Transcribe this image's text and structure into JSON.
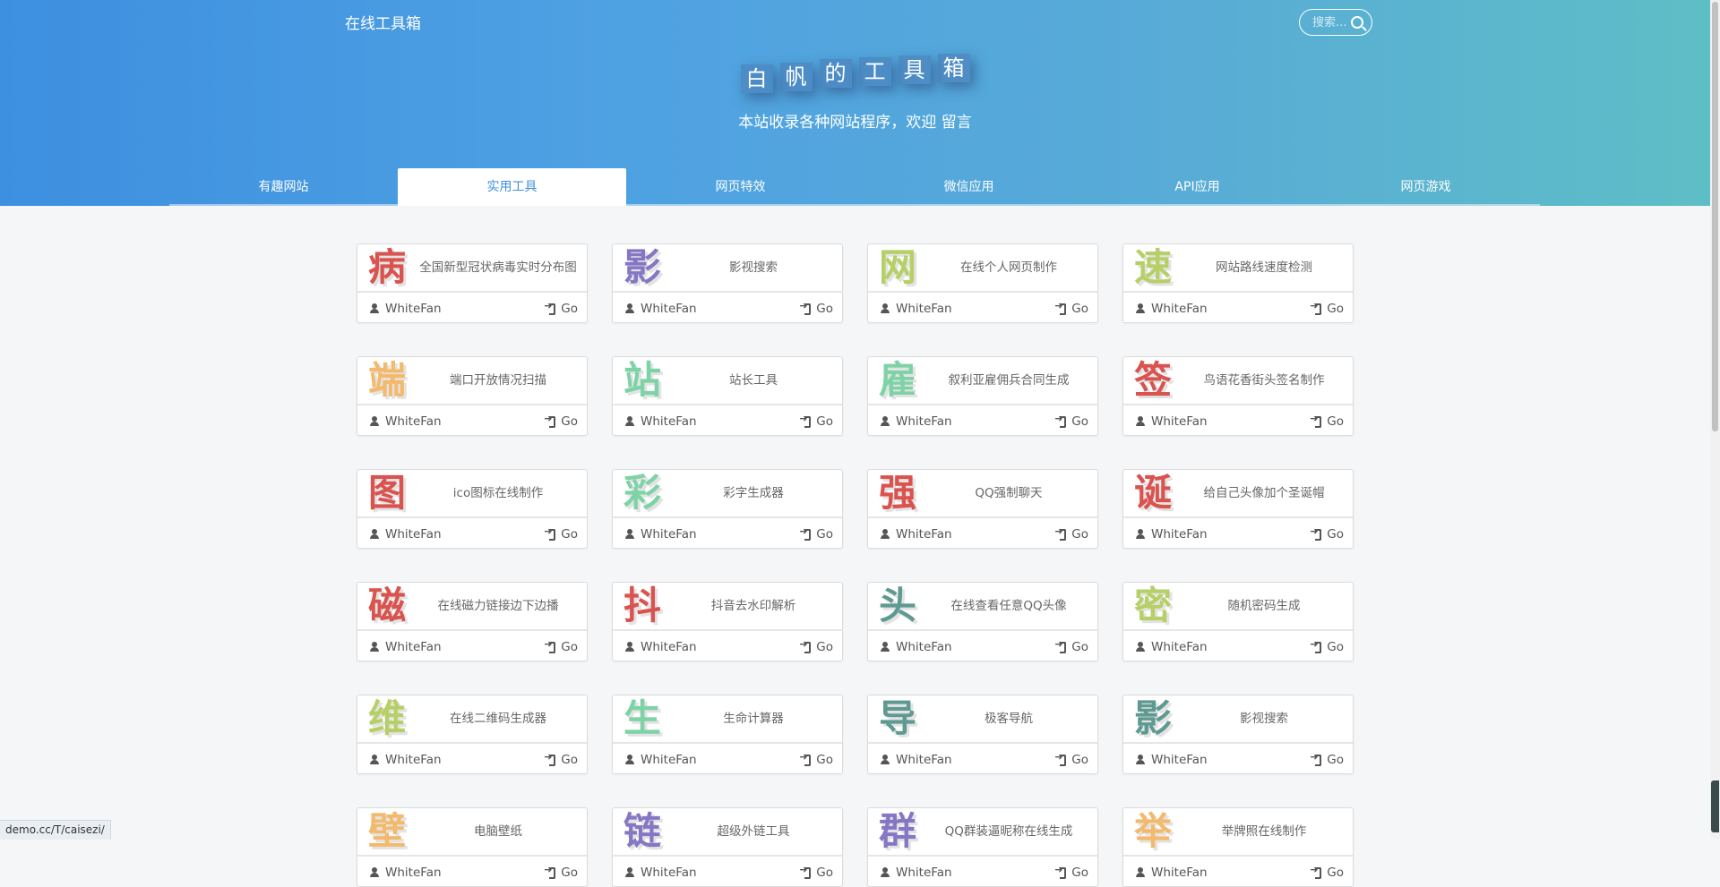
{
  "header": {
    "brand": "在线工具箱",
    "search_placeholder": "搜索...",
    "title_chars": [
      "白",
      "帆",
      "的",
      "工",
      "具",
      "箱"
    ],
    "subtitle_prefix": "本站收录各种网站程序，欢迎",
    "subtitle_link": "留言"
  },
  "tabs": [
    {
      "label": "有趣网站",
      "active": false
    },
    {
      "label": "实用工具",
      "active": true
    },
    {
      "label": "网页特效",
      "active": false
    },
    {
      "label": "微信应用",
      "active": false
    },
    {
      "label": "API应用",
      "active": false
    },
    {
      "label": "网页游戏",
      "active": false
    }
  ],
  "cards": [
    {
      "char": "病",
      "color": "#d9534f",
      "title": "全国新型冠状病毒实时分布图",
      "author": "WhiteFan",
      "go": "Go"
    },
    {
      "char": "影",
      "color": "#8577c4",
      "title": "影视搜索",
      "author": "WhiteFan",
      "go": "Go"
    },
    {
      "char": "网",
      "color": "#b6cf66",
      "title": "在线个人网页制作",
      "author": "WhiteFan",
      "go": "Go"
    },
    {
      "char": "速",
      "color": "#b6cf66",
      "title": "网站路线速度检测",
      "author": "WhiteFan",
      "go": "Go"
    },
    {
      "char": "端",
      "color": "#f3b96c",
      "title": "端口开放情况扫描",
      "author": "WhiteFan",
      "go": "Go"
    },
    {
      "char": "站",
      "color": "#7ed3a6",
      "title": "站长工具",
      "author": "WhiteFan",
      "go": "Go"
    },
    {
      "char": "雇",
      "color": "#7ed3a6",
      "title": "叙利亚雇佣兵合同生成",
      "author": "WhiteFan",
      "go": "Go"
    },
    {
      "char": "签",
      "color": "#d9534f",
      "title": "鸟语花香街头签名制作",
      "author": "WhiteFan",
      "go": "Go"
    },
    {
      "char": "图",
      "color": "#d9534f",
      "title": "ico图标在线制作",
      "author": "WhiteFan",
      "go": "Go"
    },
    {
      "char": "彩",
      "color": "#7ed3a6",
      "title": "彩字生成器",
      "author": "WhiteFan",
      "go": "Go"
    },
    {
      "char": "强",
      "color": "#d9534f",
      "title": "QQ强制聊天",
      "author": "WhiteFan",
      "go": "Go"
    },
    {
      "char": "诞",
      "color": "#d9534f",
      "title": "给自己头像加个圣诞帽",
      "author": "WhiteFan",
      "go": "Go"
    },
    {
      "char": "磁",
      "color": "#d9534f",
      "title": "在线磁力链接边下边播",
      "author": "WhiteFan",
      "go": "Go"
    },
    {
      "char": "抖",
      "color": "#d9534f",
      "title": "抖音去水印解析",
      "author": "WhiteFan",
      "go": "Go"
    },
    {
      "char": "头",
      "color": "#5f9a92",
      "title": "在线查看任意QQ头像",
      "author": "WhiteFan",
      "go": "Go"
    },
    {
      "char": "密",
      "color": "#b6cf66",
      "title": "随机密码生成",
      "author": "WhiteFan",
      "go": "Go"
    },
    {
      "char": "维",
      "color": "#b6cf66",
      "title": "在线二维码生成器",
      "author": "WhiteFan",
      "go": "Go"
    },
    {
      "char": "生",
      "color": "#7ed3a6",
      "title": "生命计算器",
      "author": "WhiteFan",
      "go": "Go"
    },
    {
      "char": "导",
      "color": "#5f9a92",
      "title": "极客导航",
      "author": "WhiteFan",
      "go": "Go"
    },
    {
      "char": "影",
      "color": "#5f9a92",
      "title": "影视搜索",
      "author": "WhiteFan",
      "go": "Go"
    },
    {
      "char": "壁",
      "color": "#f3b96c",
      "title": "电脑壁纸",
      "author": "WhiteFan",
      "go": "Go"
    },
    {
      "char": "链",
      "color": "#8577c4",
      "title": "超级外链工具",
      "author": "WhiteFan",
      "go": "Go"
    },
    {
      "char": "群",
      "color": "#8577c4",
      "title": "QQ群装逼昵称在线生成",
      "author": "WhiteFan",
      "go": "Go"
    },
    {
      "char": "举",
      "color": "#f3b96c",
      "title": "举牌照在线制作",
      "author": "WhiteFan",
      "go": "Go"
    }
  ],
  "status_bar": {
    "url": "demo.cc/T/caisezi/"
  }
}
